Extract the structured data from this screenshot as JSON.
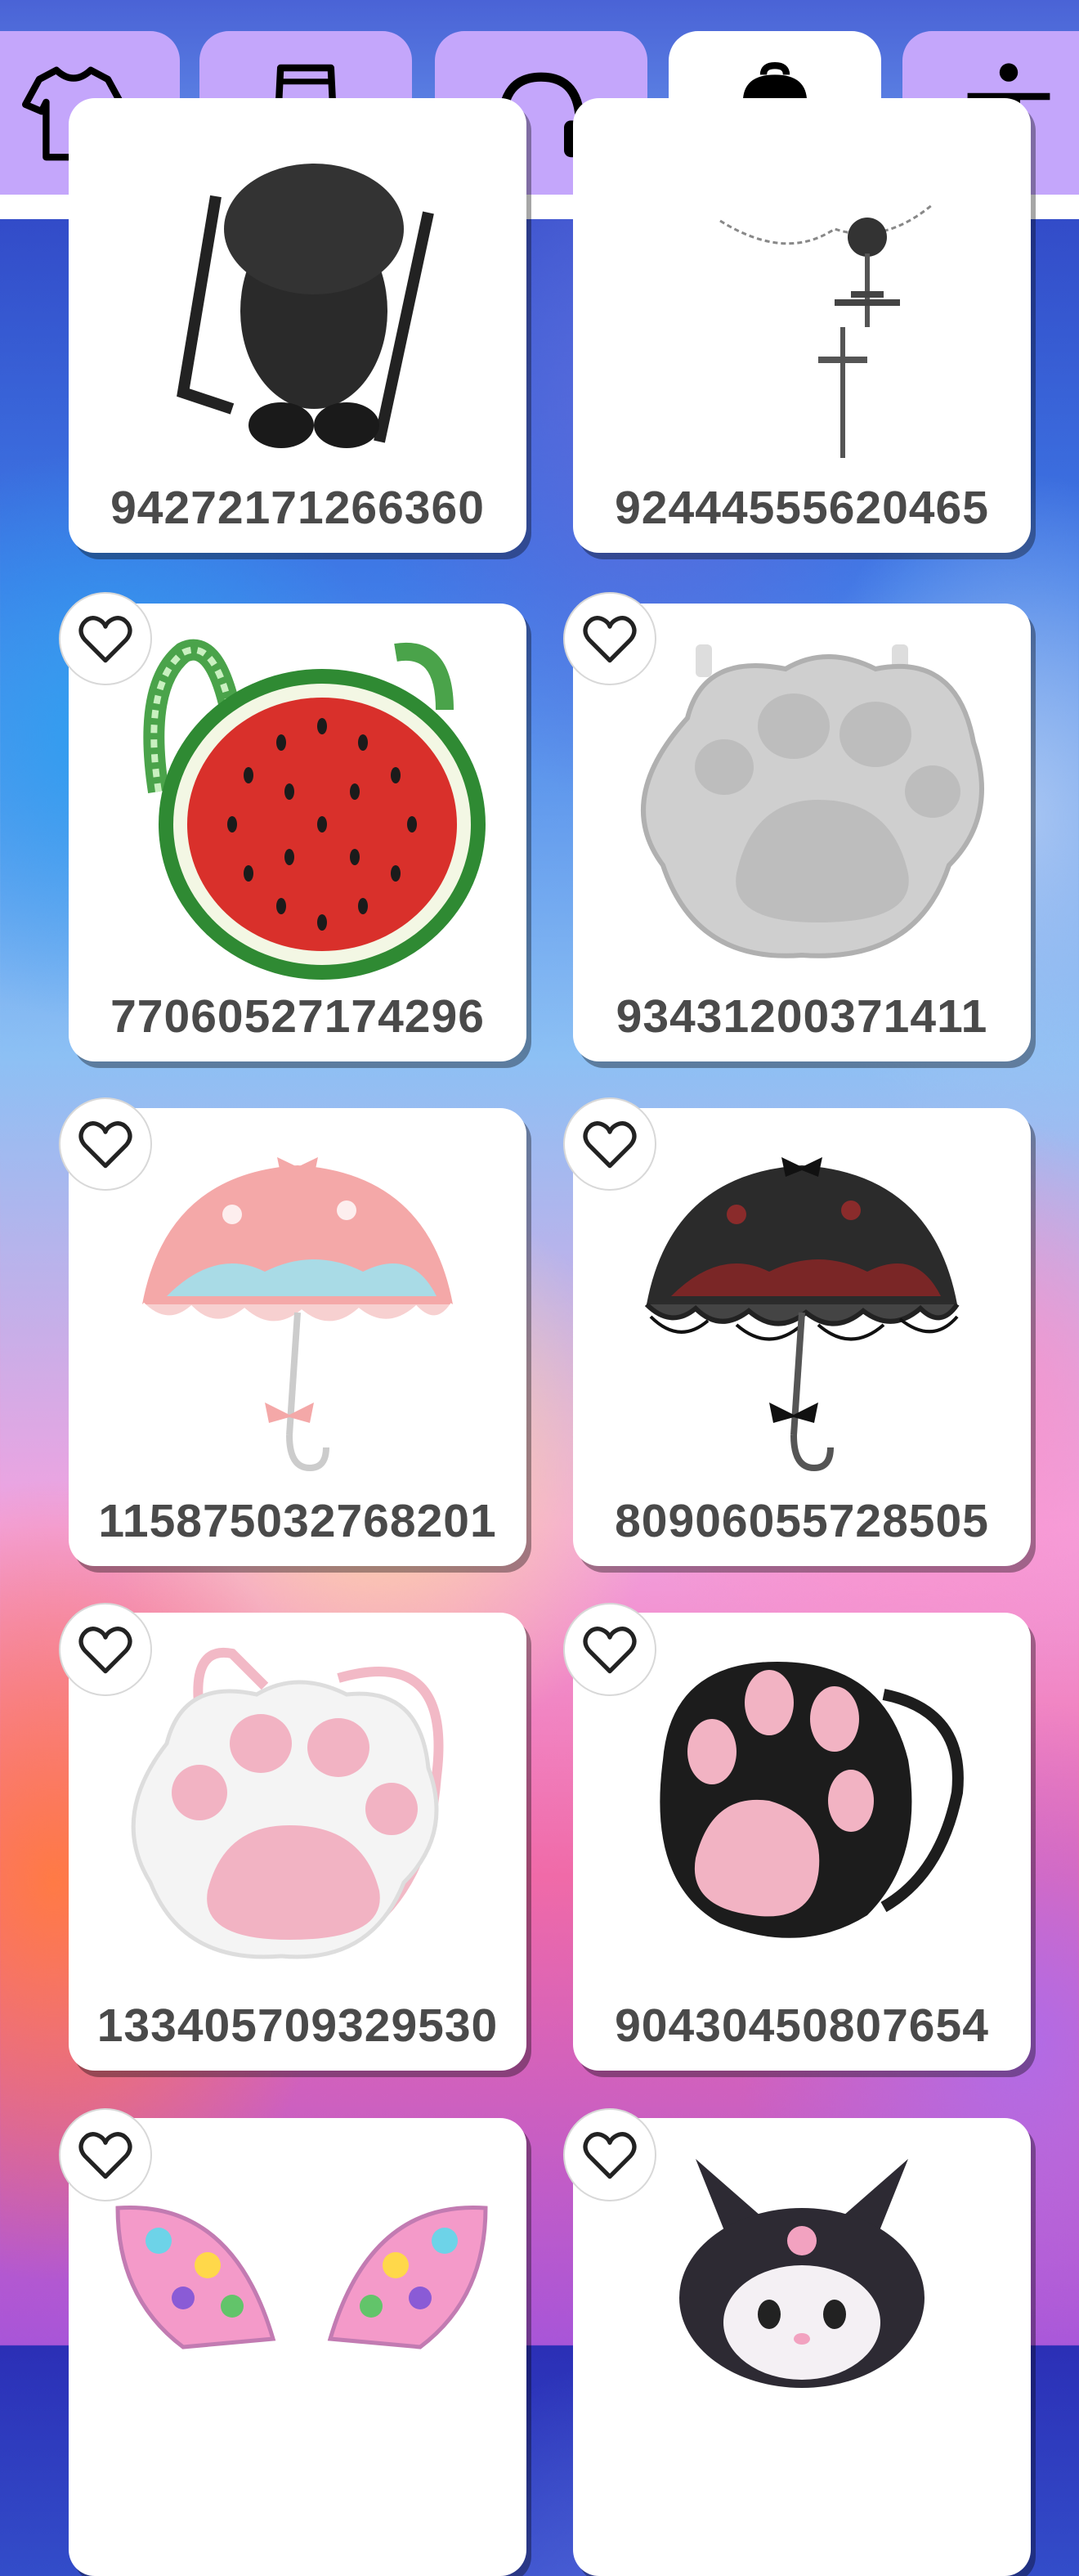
{
  "tabs": [
    {
      "label": "Shirts",
      "icon": "tshirt-icon",
      "active": false
    },
    {
      "label": "Pants",
      "icon": "pants-icon",
      "active": false
    },
    {
      "label": "Headphones",
      "icon": "headphones-icon",
      "active": false
    },
    {
      "label": "Backpacks",
      "icon": "backpack-icon",
      "active": true
    },
    {
      "label": "Body",
      "icon": "person-icon",
      "active": false
    }
  ],
  "items": [
    {
      "code": "94272171266360",
      "image": "black-creature-backpack"
    },
    {
      "code": "92444555620465",
      "image": "gothic-cross-chain"
    },
    {
      "code": "77060527174296",
      "image": "watermelon-backpack"
    },
    {
      "code": "93431200371411",
      "image": "silver-paw-backpack"
    },
    {
      "code": "115875032768201",
      "image": "pink-umbrella"
    },
    {
      "code": "80906055728505",
      "image": "black-umbrella"
    },
    {
      "code": "133405709329530",
      "image": "white-pink-paw-backpack"
    },
    {
      "code": "90430450807654",
      "image": "black-paw-backpack"
    },
    {
      "code": "",
      "image": "butterfly-wings"
    },
    {
      "code": "",
      "image": "kuromi-backpack"
    }
  ],
  "colors": {
    "tab": "#c4a6fb",
    "tab_active": "#ffffff",
    "code_text": "#4a4a4a"
  }
}
